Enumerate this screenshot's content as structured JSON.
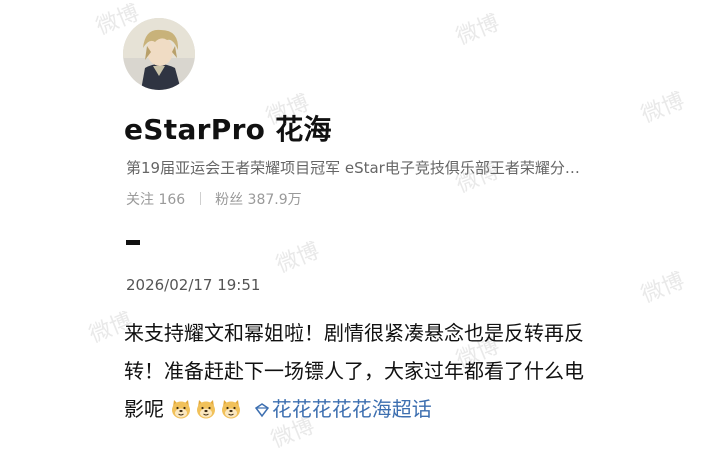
{
  "watermark": {
    "text": "微博"
  },
  "profile": {
    "name": "eStarPro 花海",
    "bio": "第19届亚运会王者荣耀项目冠军   eStar电子竞技俱乐部王者荣耀分…",
    "follow_label": "关注",
    "follow_count": "166",
    "fans_label": "粉丝",
    "fans_count": "387.9万"
  },
  "post": {
    "timestamp": "2026/02/17 19:51",
    "text": "来支持耀文和幂姐啦！剧情很紧凑悬念也是反转再反转！准备赶赴下一场镖人了，大家过年都看了什么电影呢",
    "emojis": [
      "doge-emoji",
      "doge-emoji",
      "doge-emoji"
    ],
    "topic_link": "花花花花花海超话"
  },
  "colors": {
    "link": "#3d6fb0",
    "muted": "#9a9a9a",
    "text": "#111111"
  }
}
